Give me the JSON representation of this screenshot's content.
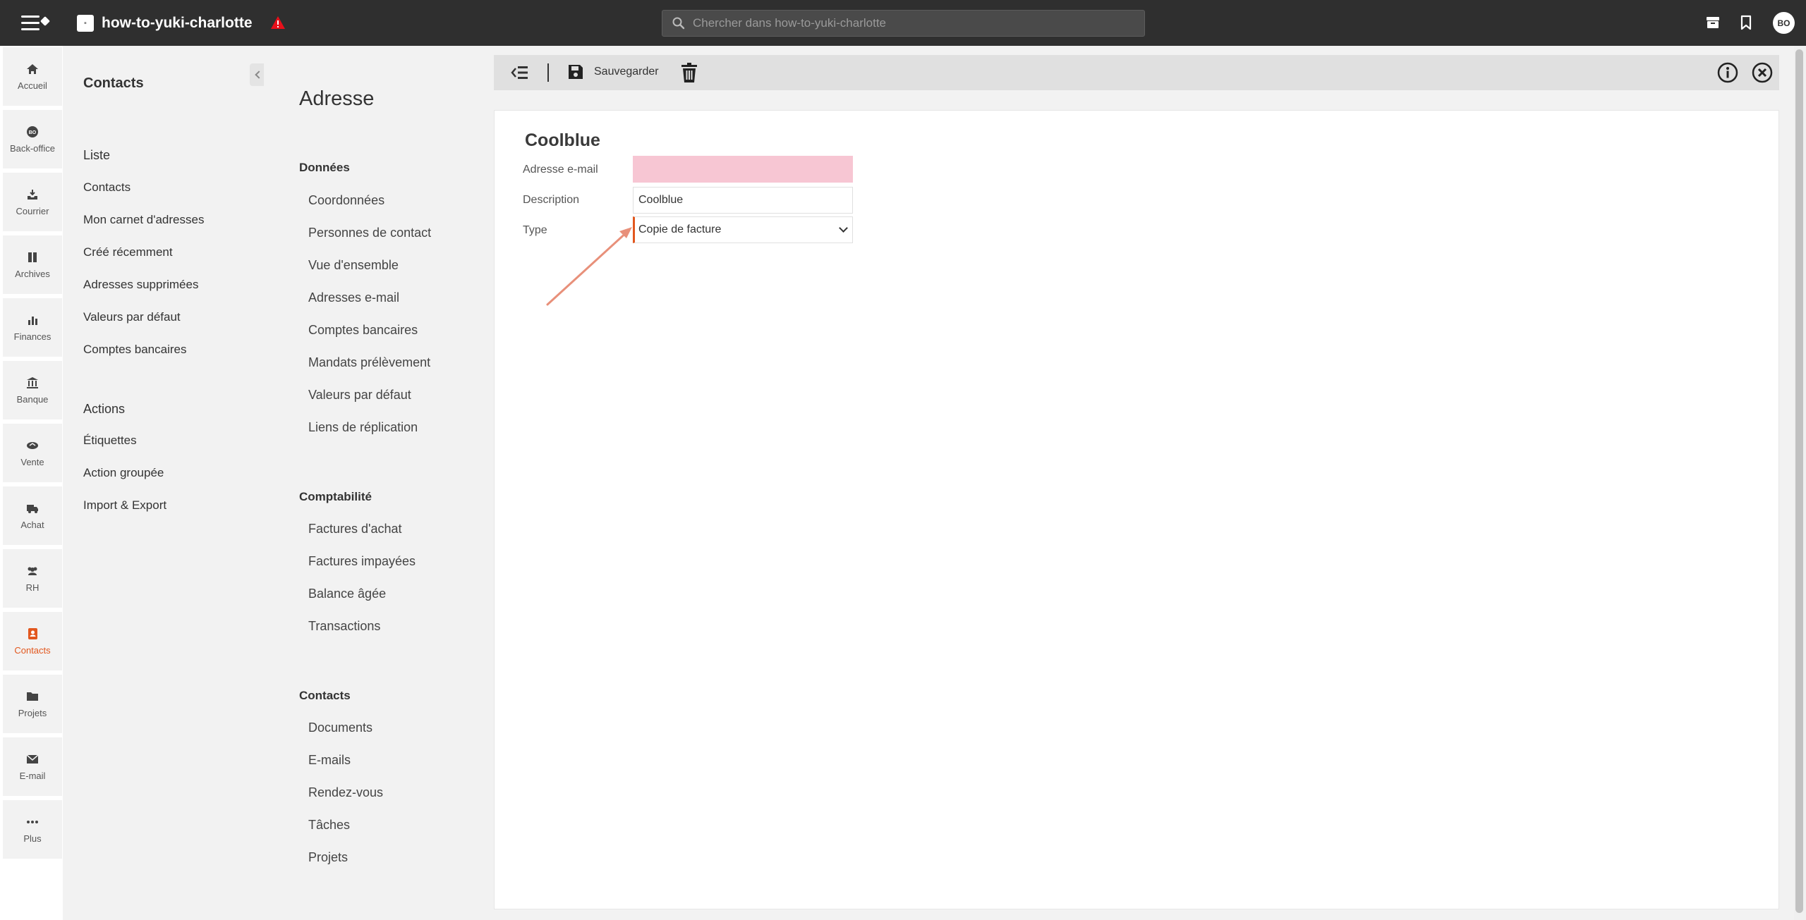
{
  "topbar": {
    "app_title": "how-to-yuki-charlotte",
    "search_placeholder": "Chercher dans how-to-yuki-charlotte",
    "avatar_initials": "BO"
  },
  "rail": {
    "accent_color": "#e2571e",
    "items": [
      {
        "label": "Accueil",
        "icon": "home-icon"
      },
      {
        "label": "Back-office",
        "icon": "backoffice-icon"
      },
      {
        "label": "Courrier",
        "icon": "inbox-icon"
      },
      {
        "label": "Archives",
        "icon": "archive-icon"
      },
      {
        "label": "Finances",
        "icon": "chart-icon"
      },
      {
        "label": "Banque",
        "icon": "bank-icon"
      },
      {
        "label": "Vente",
        "icon": "handshake-icon"
      },
      {
        "label": "Achat",
        "icon": "truck-icon"
      },
      {
        "label": "RH",
        "icon": "people-icon"
      },
      {
        "label": "Contacts",
        "icon": "contacts-icon",
        "active": true
      },
      {
        "label": "Projets",
        "icon": "folder-icon"
      },
      {
        "label": "E-mail",
        "icon": "envelope-icon"
      },
      {
        "label": "Plus",
        "icon": "more-icon"
      }
    ]
  },
  "sidebar": {
    "title": "Contacts",
    "liste_heading": "Liste",
    "liste": [
      "Contacts",
      "Mon carnet d'adresses",
      "Créé récemment",
      "Adresses supprimées",
      "Valeurs par défaut",
      "Comptes bancaires"
    ],
    "actions_heading": "Actions",
    "actions": [
      "Étiquettes",
      "Action groupée",
      "Import & Export"
    ]
  },
  "panel": {
    "title": "Adresse",
    "donnees_heading": "Données",
    "donnees": [
      "Coordonnées",
      "Personnes de contact",
      "Vue d'ensemble",
      "Adresses e-mail",
      "Comptes bancaires",
      "Mandats prélèvement",
      "Valeurs par défaut",
      "Liens de réplication"
    ],
    "compta_heading": "Comptabilité",
    "compta": [
      "Factures d'achat",
      "Factures impayées",
      "Balance âgée",
      "Transactions"
    ],
    "contacts_heading": "Contacts",
    "contacts": [
      "Documents",
      "E-mails",
      "Rendez-vous",
      "Tâches",
      "Projets"
    ]
  },
  "toolbar": {
    "save_label": "Sauvegarder"
  },
  "form": {
    "record_title": "Coolblue",
    "email_label": "Adresse e-mail",
    "email_value": "",
    "description_label": "Description",
    "description_value": "Coolblue",
    "type_label": "Type",
    "type_value": "Copie de facture",
    "invalid_field_color": "#f7c6d3",
    "annotation_arrow_color": "#e8907a"
  }
}
